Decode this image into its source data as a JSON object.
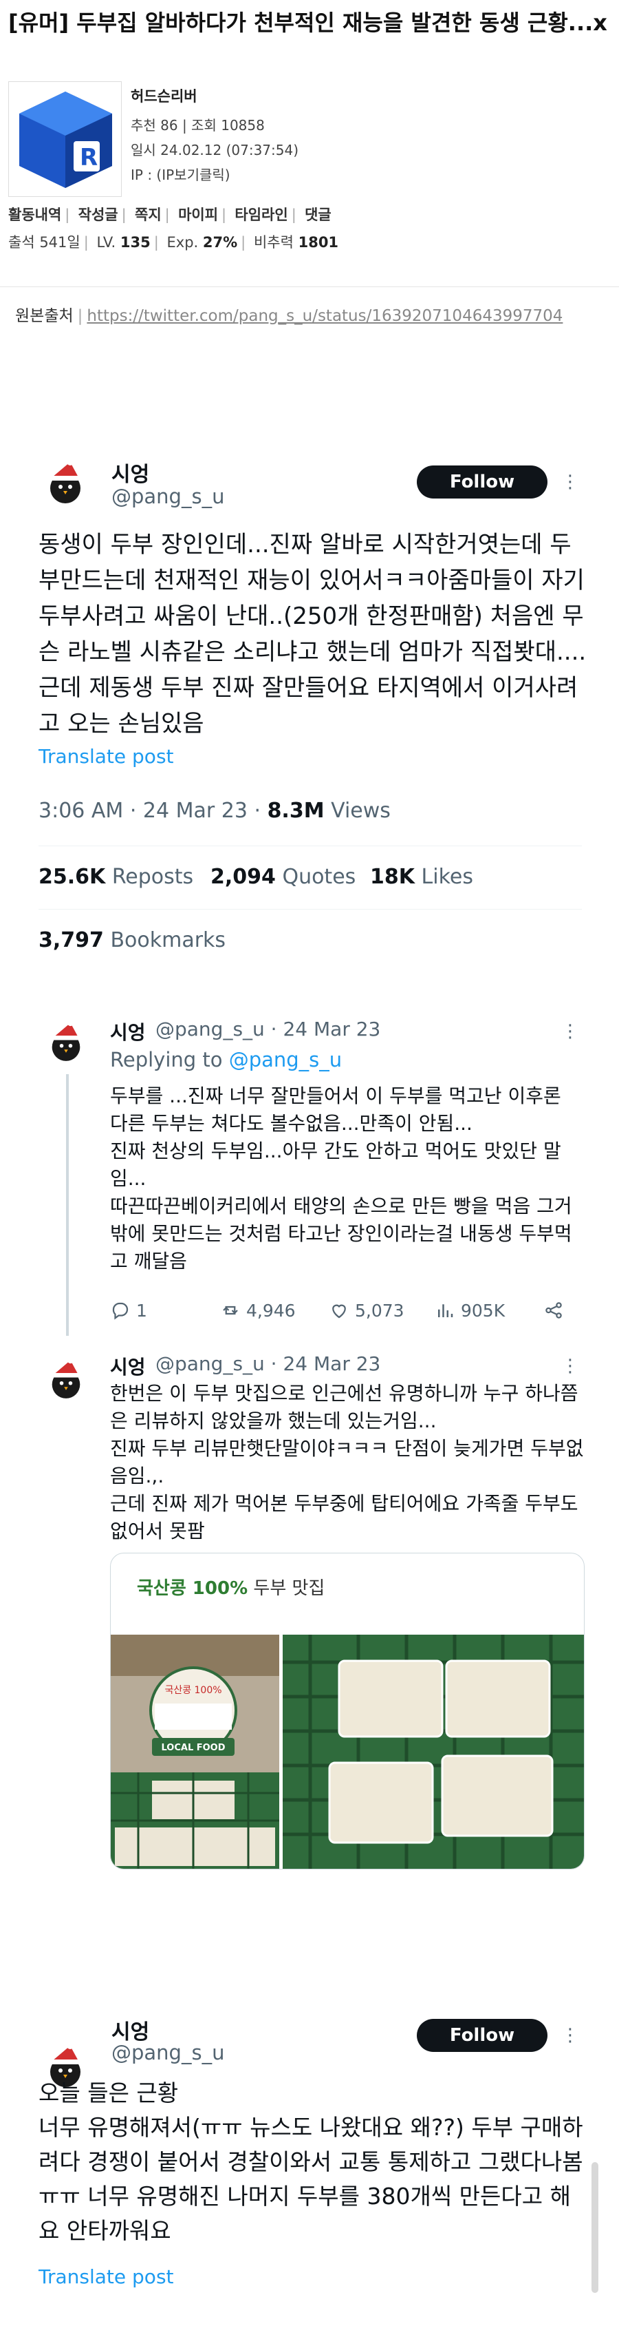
{
  "post": {
    "title": "[유머] 두부집 알바하다가 천부적인 재능을 발견한 동생 근황...x",
    "author": "허드슨리버",
    "recommend": "추천 86 | 조회 10858",
    "date": "일시 24.02.12 (07:37:54)",
    "ip": "IP : (IP보기클릭)",
    "activity_links": [
      "활동내역",
      "작성글",
      "쪽지",
      "마이피",
      "타임라인",
      "댓글"
    ],
    "attendance_label": "출석 541일",
    "level_label": "LV.",
    "level_value": "135",
    "exp_label": "Exp.",
    "exp_value": "27%",
    "ratio_label": "비추력",
    "ratio_value": "1801",
    "source_label": "원본출처",
    "source_url": "https://twitter.com/pang_s_u/status/1639207104643997704"
  },
  "main_tweet": {
    "name": "시엉",
    "handle": "@pang_s_u",
    "follow_label": "Follow",
    "body": "동생이 두부 장인인데...진짜 알바로 시작한거엿는데 두부만드는데 천재적인 재능이 있어서ㅋㅋ아줌마들이 자기 두부사려고 싸움이 난대..(250개 한정판매함) 처음엔 무슨 라노벨 시츄같은 소리냐고 했는데 엄마가 직접봣대....근데 제동생 두부 진짜 잘만들어요 타지역에서 이거사려고 오는 손님있음",
    "translate": "Translate post",
    "time": "3:06 AM · 24 Mar 23 · ",
    "views_value": "8.3M",
    "views_label": " Views",
    "reposts_value": "25.6K",
    "reposts_label": "Reposts",
    "quotes_value": "2,094",
    "quotes_label": "Quotes",
    "likes_value": "18K",
    "likes_label": "Likes",
    "bookmarks_value": "3,797",
    "bookmarks_label": "Bookmarks"
  },
  "reply1": {
    "name": "시엉",
    "meta": "@pang_s_u · 24 Mar 23",
    "replying_prefix": "Replying to ",
    "replying_handle": "@pang_s_u",
    "body_lines": [
      "두부를 ...진짜 너무 잘만들어서 이 두부를 먹고난 이후론 다른 두부는 쳐다도 볼수없음...만족이 안됨...",
      "진짜 천상의 두부임...아무 간도 안하고 먹어도 맛있단 말임...",
      "따끈따끈베이커리에서 태양의 손으로 만든 빵을 먹음 그거밖에 못만드는 것처럼 타고난 장인이라는걸 내동생 두부먹고 깨달음"
    ],
    "replies": "1",
    "retweets": "4,946",
    "likes": "5,073",
    "views": "905K"
  },
  "reply2": {
    "name": "시엉",
    "meta": "@pang_s_u · 24 Mar 23",
    "body_lines": [
      "한번은 이 두부 맛집으로 인근에선 유명하니까 누구 하나쯤은 리뷰하지 않았을까 했는데 있는거임...",
      "진짜 두부 리뷰만햇단말이야ㅋㅋㅋ 단점이 늦게가면 두부없음임.,.",
      "근데 진짜 제가 먹어본 두부중에 탑티어에요 가족줄 두부도 없어서 못팜"
    ],
    "media_caption_green": "국산콩 100%",
    "media_caption_rest": " 두부 맛집",
    "photo_sign_1": "국산콩 100%",
    "photo_sign_2": "LOCAL FOOD"
  },
  "tweet3": {
    "name": "시엉",
    "handle": "@pang_s_u",
    "follow_label": "Follow",
    "body_lines": [
      "오늘 들은 근황",
      "너무 유명해져서(ㅠㅠ 뉴스도 나왔대요 왜??) 두부 구매하려다 경쟁이 붙어서 경찰이와서 교통 통제하고 그랬다나봄 ㅠㅠ 너무 유명해진 나머지 두부를 380개씩 만든다고 해요 안타까워요"
    ],
    "translate": "Translate post"
  },
  "colors": {
    "link_blue": "#1d9bf0",
    "text_dark": "#0f1419",
    "text_gray": "#536471",
    "follow_bg": "#0f1419",
    "logo_blue": "#1d56c7",
    "green_label": "#2e7d32"
  },
  "icons": [
    "level-logo",
    "santa-penguin-avatar",
    "more-icon",
    "reply-icon",
    "retweet-icon",
    "heart-icon",
    "views-chart-icon",
    "share-icon"
  ]
}
